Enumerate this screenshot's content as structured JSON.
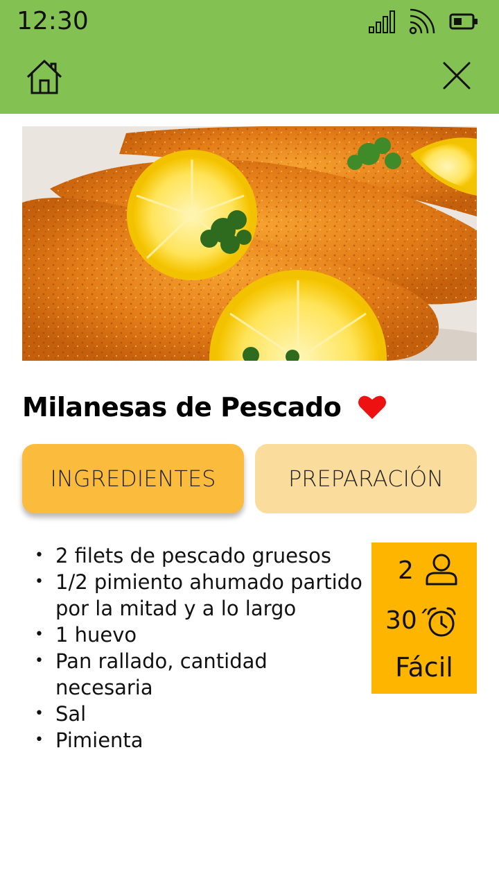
{
  "status_bar": {
    "time": "12:30",
    "icons": [
      "signal-icon",
      "wifi-icon",
      "battery-icon"
    ]
  },
  "app_bar": {
    "left_icon": "home-icon",
    "right_icon": "close-icon",
    "background_color": "#84c153"
  },
  "recipe": {
    "title": "Milanesas de Pescado",
    "favorite": true,
    "favorite_color": "#ee1111"
  },
  "tabs": [
    {
      "label": "INGREDIENTES",
      "selected": true,
      "color": "#fbbb3c"
    },
    {
      "label": "PREPARACIÓN",
      "selected": false,
      "color": "#fadc9c"
    }
  ],
  "ingredients": [
    "2 filets de pescado gruesos",
    "1/2 pimiento ahumado partido por la mitad y a lo largo",
    "1 huevo",
    "Pan rallado, cantidad necesaria",
    "Sal",
    "Pimienta"
  ],
  "info": {
    "servings": "2",
    "time": "30´",
    "difficulty": "Fácil",
    "servings_icon": "person-icon",
    "time_icon": "alarm-clock-icon",
    "background_color": "#fdb500"
  }
}
